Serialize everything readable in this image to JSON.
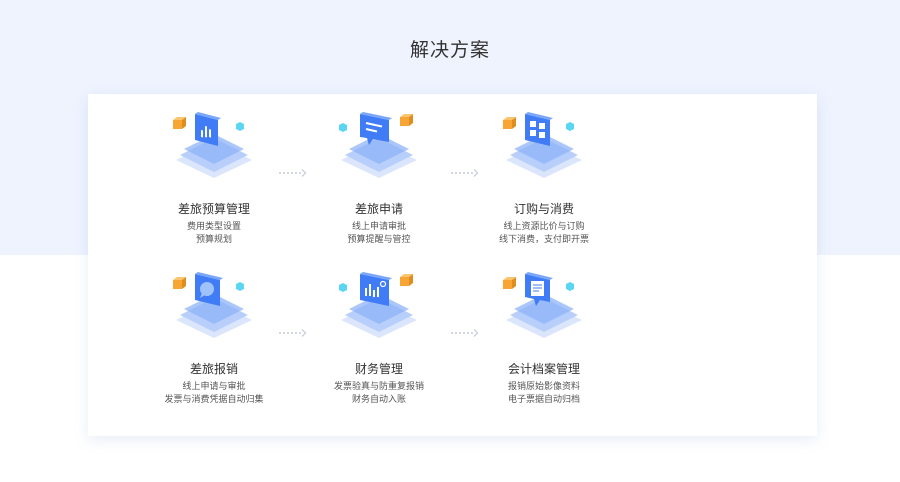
{
  "page": {
    "title": "解决方案",
    "colors": {
      "top_background": "#eef3fe",
      "card_background": "#ffffff",
      "accent_blue": "#3f7cf5",
      "accent_orange": "#f7a535",
      "accent_cyan": "#5ad5f2"
    }
  },
  "solutions": [
    {
      "title": "差旅预算管理",
      "desc": [
        "费用类型设置",
        "预算规划"
      ],
      "icon": "bar-chart-icon"
    },
    {
      "title": "差旅申请",
      "desc": [
        "线上申请审批",
        "预算提醒与管控"
      ],
      "icon": "message-icon"
    },
    {
      "title": "订购与消费",
      "desc": [
        "线上资源比价与订购",
        "线下消费，支付即开票"
      ],
      "icon": "grid-apps-icon"
    },
    {
      "title": "差旅报销",
      "desc": [
        "线上申请与审批",
        "发票与消费凭据自动归集"
      ],
      "icon": "chat-bubble-icon"
    },
    {
      "title": "财务管理",
      "desc": [
        "发票验真与防重复报销",
        "财务自动入账"
      ],
      "icon": "analytics-chart-icon"
    },
    {
      "title": "会计档案管理",
      "desc": [
        "报销原始影像资料",
        "电子票据自动归档"
      ],
      "icon": "document-icon"
    }
  ]
}
